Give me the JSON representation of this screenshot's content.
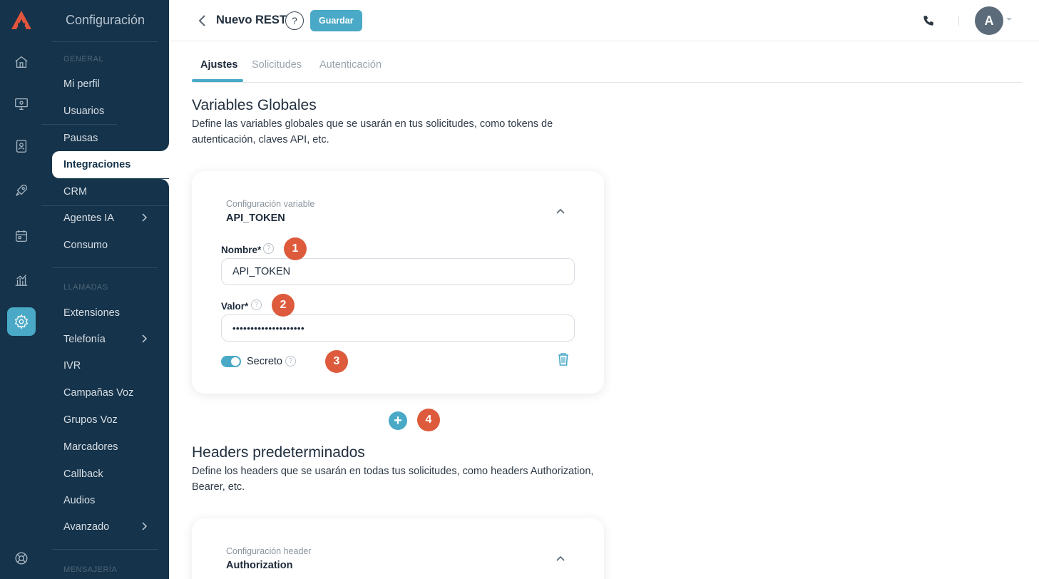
{
  "sidebar": {
    "title": "Configuración",
    "sections": {
      "general": "GENERAL",
      "llamadas": "LLAMADAS",
      "mensajeria": "MENSAJERÍA"
    },
    "items": [
      {
        "label": "Mi perfil"
      },
      {
        "label": "Usuarios"
      },
      {
        "label": "Pausas"
      },
      {
        "label": "Integraciones",
        "active": true
      },
      {
        "label": "CRM"
      },
      {
        "label": "Agentes IA",
        "has_children": true
      },
      {
        "label": "Consumo"
      },
      {
        "label": "Extensiones"
      },
      {
        "label": "Telefonía",
        "has_children": true
      },
      {
        "label": "IVR"
      },
      {
        "label": "Campañas Voz"
      },
      {
        "label": "Grupos Voz"
      },
      {
        "label": "Marcadores"
      },
      {
        "label": "Callback"
      },
      {
        "label": "Audios"
      },
      {
        "label": "Avanzado",
        "has_children": true
      }
    ]
  },
  "rail": {
    "icons": [
      "home-icon",
      "monitor-icon",
      "contacts-icon",
      "rocket-icon",
      "calendar-icon",
      "stats-icon",
      "gear-icon",
      "help-lifebuoy-icon"
    ],
    "active": "gear-icon"
  },
  "header": {
    "title": "Nuevo REST",
    "help_glyph": "?",
    "save_label": "Guardar",
    "avatar_initial": "A"
  },
  "tabs": [
    {
      "label": "Ajustes",
      "active": true
    },
    {
      "label": "Solicitudes"
    },
    {
      "label": "Autenticación"
    }
  ],
  "variables": {
    "title": "Variables Globales",
    "description": "Define las variables globales que se usarán en tus solicitudes, como tokens de autenticación, claves API, etc.",
    "card": {
      "subtitle": "Configuración variable",
      "name": "API_TOKEN",
      "name_label": "Nombre*",
      "name_value": "API_TOKEN",
      "value_label": "Valor*",
      "value_masked": "••••••••••••••••••••",
      "secret_label": "Secreto",
      "secret_on": true
    }
  },
  "headers": {
    "title": "Headers predeterminados",
    "description": "Define los headers que se usarán en todas tus solicitudes, como headers Authorization, Bearer, etc.",
    "card": {
      "subtitle": "Configuración header",
      "name": "Authorization"
    }
  },
  "badges": [
    "1",
    "2",
    "3",
    "4"
  ],
  "add_glyph": "+",
  "colors": {
    "sidebar_bg": "#15334a",
    "accent": "#49a9c6",
    "badge": "#dd5b3c"
  }
}
